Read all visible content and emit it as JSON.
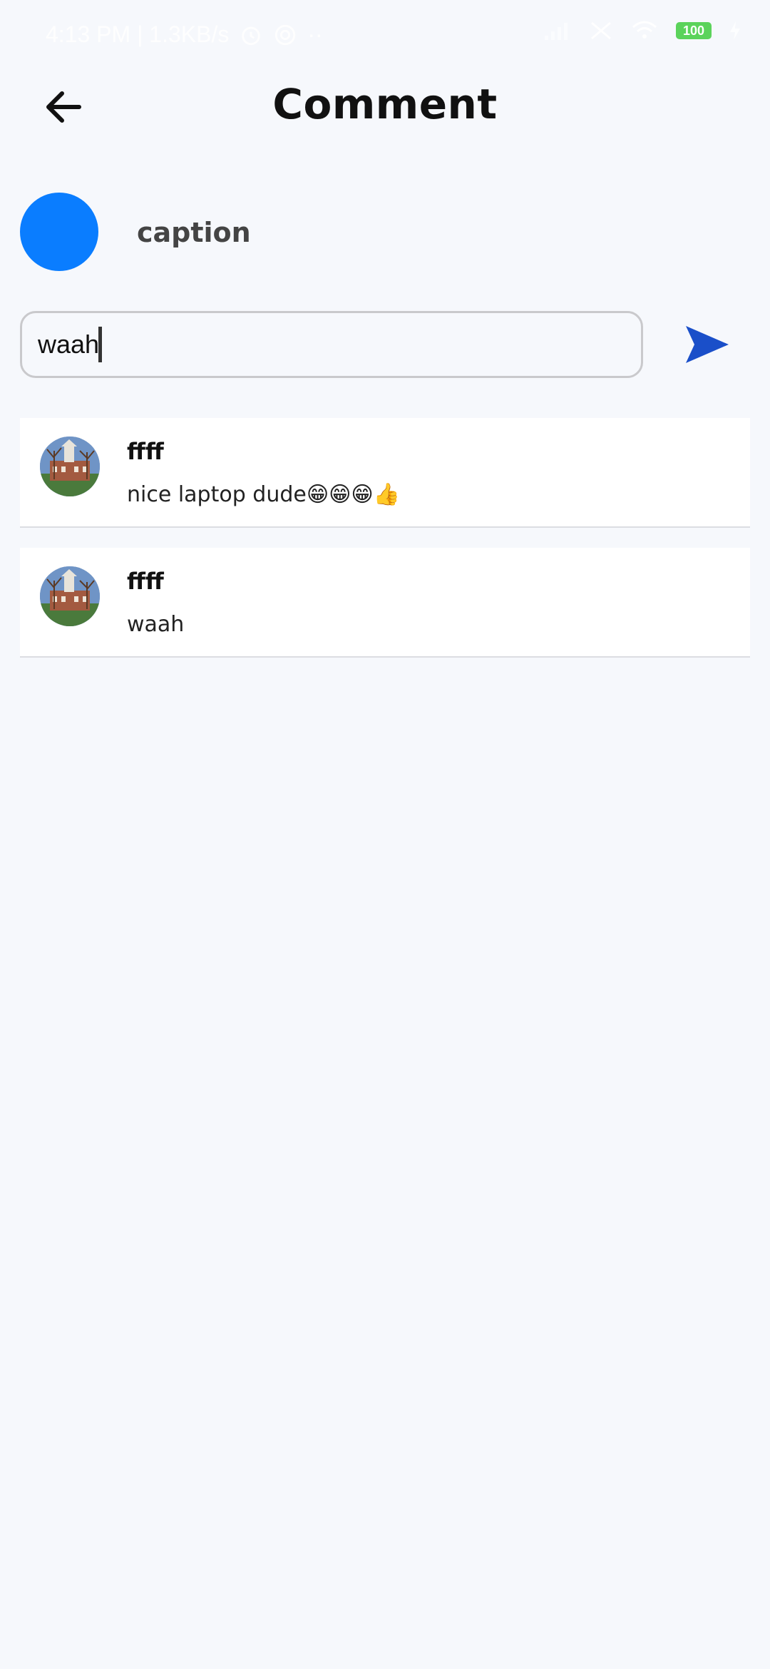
{
  "status_bar": {
    "time_speed": "4:13 PM | 1.3KB/s",
    "battery": "100",
    "icons": [
      "alarm-icon",
      "at-icon",
      "more-dots-icon",
      "signal-icon",
      "no-sim-icon",
      "wifi-icon",
      "battery-icon",
      "charging-icon"
    ]
  },
  "header": {
    "title": "Comment",
    "back_icon": "arrow-left-icon"
  },
  "post": {
    "caption": "caption",
    "avatar_color": "#0a7dff"
  },
  "composer": {
    "value": "waah",
    "send_icon": "send-icon",
    "send_color": "#1a4fc9"
  },
  "comments": [
    {
      "user": "ffff",
      "text": "nice laptop dude😁😁😁👍"
    },
    {
      "user": "ffff",
      "text": "waah"
    }
  ]
}
